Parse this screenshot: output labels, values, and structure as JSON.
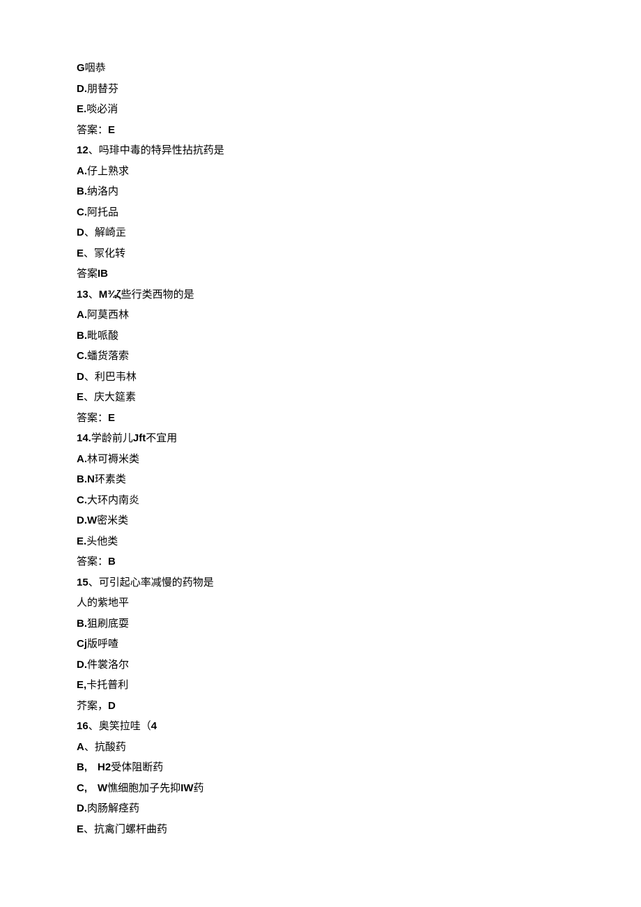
{
  "lines": [
    {
      "parts": [
        {
          "t": "G",
          "b": true
        },
        {
          "t": "咽恭",
          "b": false
        }
      ]
    },
    {
      "parts": [
        {
          "t": "D.",
          "b": true
        },
        {
          "t": "朋替芬",
          "b": false
        }
      ]
    },
    {
      "parts": [
        {
          "t": "E.",
          "b": true
        },
        {
          "t": "啖必消",
          "b": false
        }
      ]
    },
    {
      "parts": [
        {
          "t": "答案：",
          "b": false
        },
        {
          "t": "E",
          "b": true
        }
      ]
    },
    {
      "parts": [
        {
          "t": "12",
          "b": true
        },
        {
          "t": "、吗琲中毒的特异性拈抗药是",
          "b": false
        }
      ]
    },
    {
      "parts": [
        {
          "t": "A.",
          "b": true
        },
        {
          "t": "仔上熟求",
          "b": false
        }
      ]
    },
    {
      "parts": [
        {
          "t": "B.",
          "b": true
        },
        {
          "t": "纳洛内",
          "b": false
        }
      ]
    },
    {
      "parts": [
        {
          "t": "C.",
          "b": true
        },
        {
          "t": "阿托品",
          "b": false
        }
      ]
    },
    {
      "parts": [
        {
          "t": "D",
          "b": true
        },
        {
          "t": "、解崎㱏",
          "b": false
        }
      ]
    },
    {
      "parts": [
        {
          "t": "E",
          "b": true
        },
        {
          "t": "、冡化转",
          "b": false
        }
      ]
    },
    {
      "parts": [
        {
          "t": "答案",
          "b": false
        },
        {
          "t": "IB",
          "b": true
        }
      ]
    },
    {
      "parts": [
        {
          "t": "13",
          "b": true
        },
        {
          "t": "、",
          "b": false
        },
        {
          "t": "M¾ζ",
          "b": true
        },
        {
          "t": "些行类西物的是",
          "b": false
        }
      ]
    },
    {
      "parts": [
        {
          "t": "A.",
          "b": true
        },
        {
          "t": "阿莫西林",
          "b": false
        }
      ]
    },
    {
      "parts": [
        {
          "t": "B.",
          "b": true
        },
        {
          "t": "毗哌酸",
          "b": false
        }
      ]
    },
    {
      "parts": [
        {
          "t": "C.",
          "b": true
        },
        {
          "t": "蟠货落索",
          "b": false
        }
      ]
    },
    {
      "parts": [
        {
          "t": "D",
          "b": true
        },
        {
          "t": "、利巴韦林",
          "b": false
        }
      ]
    },
    {
      "parts": [
        {
          "t": "E",
          "b": true
        },
        {
          "t": "、庆大筵素",
          "b": false
        }
      ]
    },
    {
      "parts": [
        {
          "t": "答案：",
          "b": false
        },
        {
          "t": "E",
          "b": true
        }
      ]
    },
    {
      "parts": [
        {
          "t": "14.",
          "b": true
        },
        {
          "t": "学龄前儿",
          "b": false
        },
        {
          "t": "Jft",
          "b": true
        },
        {
          "t": "不宜用",
          "b": false
        }
      ]
    },
    {
      "parts": [
        {
          "t": "A.",
          "b": true
        },
        {
          "t": "林可褥米类",
          "b": false
        }
      ]
    },
    {
      "parts": [
        {
          "t": "B.N",
          "b": true
        },
        {
          "t": "环素类",
          "b": false
        }
      ]
    },
    {
      "parts": [
        {
          "t": "C.",
          "b": true
        },
        {
          "t": "大环内南炎",
          "b": false
        }
      ]
    },
    {
      "parts": [
        {
          "t": "D.W",
          "b": true
        },
        {
          "t": "密米类",
          "b": false
        }
      ]
    },
    {
      "parts": [
        {
          "t": "E.",
          "b": true
        },
        {
          "t": "头他类",
          "b": false
        }
      ]
    },
    {
      "parts": [
        {
          "t": "答案：",
          "b": false
        },
        {
          "t": "B",
          "b": true
        }
      ]
    },
    {
      "parts": [
        {
          "t": "15",
          "b": true
        },
        {
          "t": "、可引起心率减慢的药物是",
          "b": false
        }
      ]
    },
    {
      "parts": [
        {
          "t": "人的紫地平",
          "b": false
        }
      ]
    },
    {
      "parts": [
        {
          "t": "B.",
          "b": true
        },
        {
          "t": "狙刷底耍",
          "b": false
        }
      ]
    },
    {
      "parts": [
        {
          "t": "Cj",
          "b": true
        },
        {
          "t": "版呼喳",
          "b": false
        }
      ]
    },
    {
      "parts": [
        {
          "t": "D.",
          "b": true
        },
        {
          "t": "件裳洛尔",
          "b": false
        }
      ]
    },
    {
      "parts": [
        {
          "t": "E,",
          "b": true
        },
        {
          "t": "卡托普利",
          "b": false
        }
      ]
    },
    {
      "parts": [
        {
          "t": "芥案，",
          "b": false
        },
        {
          "t": "D",
          "b": true
        }
      ]
    },
    {
      "parts": [
        {
          "t": "16",
          "b": true
        },
        {
          "t": "、奥笑拉哇（",
          "b": false
        },
        {
          "t": "4",
          "b": true
        }
      ]
    },
    {
      "parts": [
        {
          "t": "A",
          "b": true
        },
        {
          "t": "、抗酸药",
          "b": false
        }
      ]
    },
    {
      "parts": [
        {
          "t": "B,　H2",
          "b": true
        },
        {
          "t": "受体阻断药",
          "b": false
        }
      ]
    },
    {
      "parts": [
        {
          "t": "C,　W",
          "b": true
        },
        {
          "t": "憔细胞加子先抑",
          "b": false
        },
        {
          "t": "IW",
          "b": true
        },
        {
          "t": "药",
          "b": false
        }
      ]
    },
    {
      "parts": [
        {
          "t": "D.",
          "b": true
        },
        {
          "t": "肉肠解痉药",
          "b": false
        }
      ]
    },
    {
      "parts": [
        {
          "t": "E",
          "b": true
        },
        {
          "t": "、抗禽门螺杆曲药",
          "b": false
        }
      ]
    }
  ]
}
